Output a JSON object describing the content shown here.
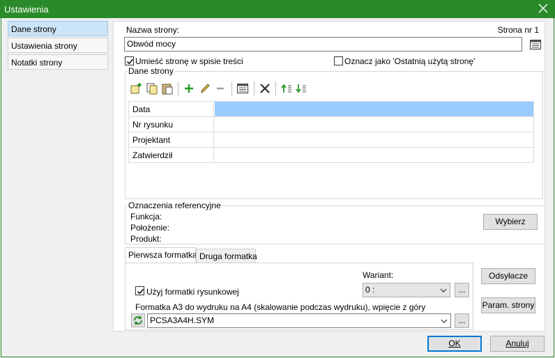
{
  "window": {
    "title": "Ustawienia"
  },
  "nav": {
    "items": [
      {
        "label": "Dane strony"
      },
      {
        "label": "Ustawienia strony"
      },
      {
        "label": "Notatki strony"
      }
    ]
  },
  "page": {
    "name_label": "Nazwa strony:",
    "page_number": "Strona nr 1",
    "name_value": "Obwód mocy",
    "include_toc_label": "Umieść stronę w spisie treści",
    "include_toc_checked": true,
    "mark_last_label": "Oznacz jako 'Ostatnią użytą stronę'",
    "mark_last_checked": false
  },
  "page_data": {
    "legend": "Dane strony",
    "rows": [
      {
        "name": "Data",
        "value": ""
      },
      {
        "name": "Nr rysunku",
        "value": ""
      },
      {
        "name": "Projektant",
        "value": ""
      },
      {
        "name": "Zatwierdził",
        "value": ""
      }
    ]
  },
  "reference": {
    "legend": "Oznaczenia referencyjne",
    "function_label": "Funkcja:",
    "location_label": "Położenie:",
    "product_label": "Produkt:",
    "choose_button": "Wybierz"
  },
  "format": {
    "tabs": [
      {
        "label": "Pierwsza formatka"
      },
      {
        "label": "Druga formatka"
      }
    ],
    "variant_label": "Wariant:",
    "variant_value": "0 :",
    "use_format_label": "Użyj formatki rysunkowej",
    "use_format_checked": true,
    "description": "Formatka A3 do wydruku na A4 (skalowanie podczas wydruku), wpięcie z góry",
    "symbol_value": "PCSA3A4H.SYM",
    "browse_label": "..."
  },
  "side_buttons": {
    "references": "Odsyłacze",
    "page_params": "Param. strony"
  },
  "footer": {
    "ok": "OK",
    "cancel": "Anuluj"
  }
}
